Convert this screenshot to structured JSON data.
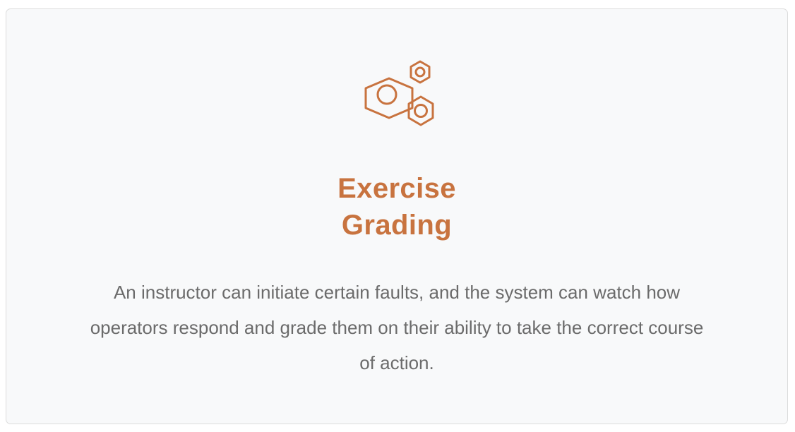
{
  "card": {
    "icon": "hexagon-nuts-icon",
    "accent_color": "#c8733f",
    "title_lines": [
      "Exercise",
      "Grading"
    ],
    "description_lines": [
      "An instructor can initiate certain faults, and the system can watch how",
      "operators respond and grade them on their ability to take the correct course",
      "of action."
    ]
  }
}
